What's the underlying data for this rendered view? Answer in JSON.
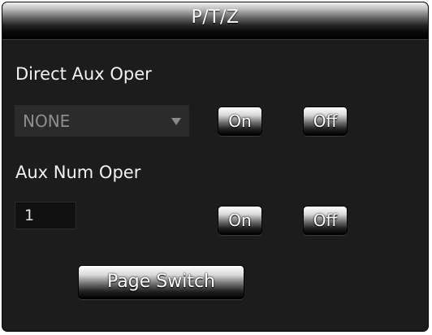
{
  "title": "P/T/Z",
  "direct_aux": {
    "label": "Direct Aux Oper",
    "select_value": "NONE",
    "on_label": "On",
    "off_label": "Off"
  },
  "aux_num": {
    "label": "Aux Num Oper",
    "value": "1",
    "on_label": "On",
    "off_label": "Off"
  },
  "page_switch_label": "Page Switch",
  "icons": {
    "dropdown": "chevron-down-icon"
  },
  "colors": {
    "panel_background": "#1c1c1c",
    "text": "#f2f2f2",
    "select_text": "#8e8e8e"
  }
}
